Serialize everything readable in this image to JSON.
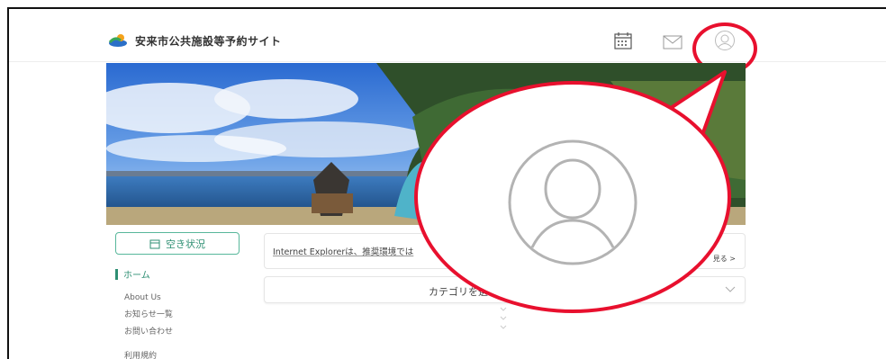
{
  "header": {
    "site_title": "安来市公共施設等予約サイト",
    "icons": [
      "calendar-icon",
      "mail-icon",
      "user-icon"
    ]
  },
  "sidebar": {
    "status_button_label": "空き状況",
    "items": [
      {
        "label": "ホーム",
        "active": true
      },
      {
        "label": "About Us"
      },
      {
        "label": "お知らせ一覧"
      },
      {
        "label": "お問い合わせ"
      },
      {
        "label": "利用規約"
      }
    ]
  },
  "notice": {
    "text": "Internet Explorerは、推奨環境では",
    "more_label": "見る >"
  },
  "category": {
    "placeholder": "カテゴリを選"
  },
  "colors": {
    "accent": "#2e8f73",
    "highlight": "#e8102e"
  }
}
